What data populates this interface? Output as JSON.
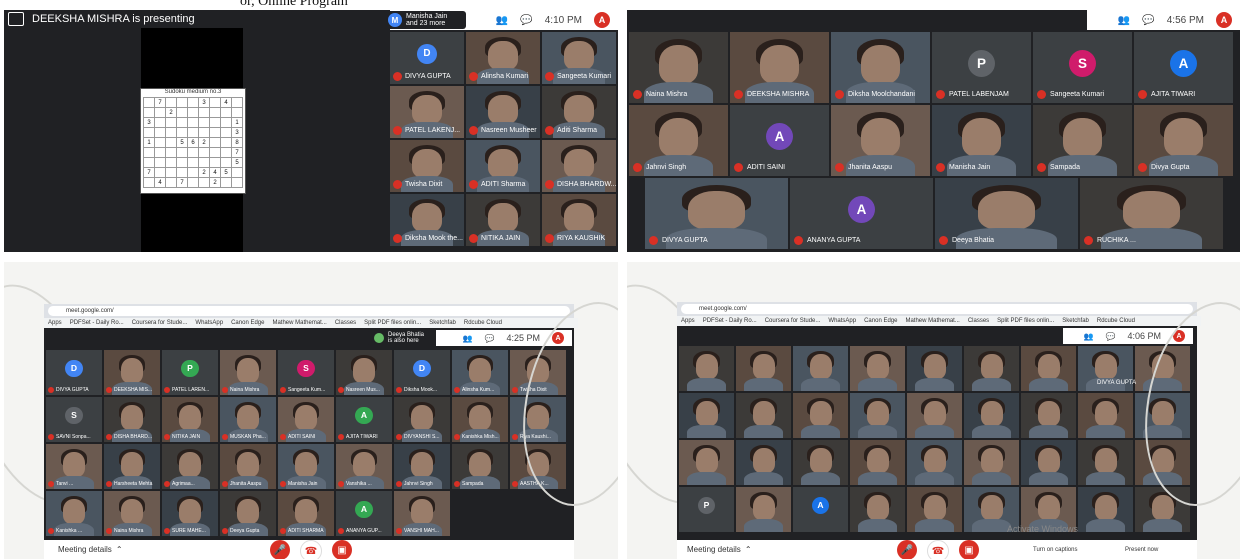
{
  "caption_fragment": "or, Online Program",
  "panel1": {
    "presenter_text": "DEEKSHA MISHRA is presenting",
    "joined_text": "Manisha Jain and 23 more",
    "joined_avatar": "M",
    "time": "4:10 PM",
    "self_avatar": "A",
    "sudoku_title": "Sudoku medium no.3",
    "sudoku_rows": [
      [
        "",
        "7",
        "",
        "",
        "",
        "3",
        "",
        "4",
        ""
      ],
      [
        "",
        "",
        "2",
        "",
        "",
        "",
        "",
        "",
        ""
      ],
      [
        "3",
        "",
        "",
        "",
        "",
        "",
        "",
        "",
        "1"
      ],
      [
        "",
        "",
        "",
        "",
        "",
        "",
        "",
        "",
        "3"
      ],
      [
        "1",
        "",
        "",
        "5",
        "6",
        "2",
        "",
        "",
        "8"
      ],
      [
        "",
        "",
        "",
        "",
        "",
        "",
        "",
        "",
        "7"
      ],
      [
        "",
        "",
        "",
        "",
        "",
        "",
        "",
        "",
        "5"
      ],
      [
        "7",
        "",
        "",
        "",
        "",
        "2",
        "4",
        "5",
        ""
      ],
      [
        "",
        "4",
        "",
        "7",
        "",
        "",
        "2",
        "",
        ""
      ]
    ],
    "tiles": [
      {
        "name": "DIVYA GUPTA",
        "avatar": "D"
      },
      {
        "name": "Alinsha Kumari"
      },
      {
        "name": "Sangeeta Kumari"
      },
      {
        "name": "PATEL LAKENJ..."
      },
      {
        "name": "Nasreen Musheer"
      },
      {
        "name": "Aditi Sharma"
      },
      {
        "name": "Twisha Dixit"
      },
      {
        "name": "ADITI Sharma"
      },
      {
        "name": "DISHA BHARDW..."
      },
      {
        "name": "Diksha Mook the..."
      },
      {
        "name": "NITIKA JAIN"
      },
      {
        "name": "RIYA KAUSHIK"
      }
    ]
  },
  "panel2": {
    "time": "4:56 PM",
    "self_avatar": "A",
    "tiles": [
      {
        "name": "Naina Mishra"
      },
      {
        "name": "DEEKSHA MISHRA"
      },
      {
        "name": "Diksha Moolchandani"
      },
      {
        "name": "PATEL LABENJAM",
        "avatar": "P"
      },
      {
        "name": "Sangeeta Kumari",
        "avatar": "S"
      },
      {
        "name": "AJITA TIWARI",
        "avatar": "A"
      },
      {
        "name": "Jahnvi Singh"
      },
      {
        "name": "ADITI SAINI",
        "avatar": "A"
      },
      {
        "name": "Jhanita Aaspu"
      },
      {
        "name": "Manisha Jain"
      },
      {
        "name": "Sampada"
      },
      {
        "name": "Divya Gupta"
      },
      {
        "name": "DIVYA GUPTA"
      },
      {
        "name": "ANANYA GUPTA",
        "avatar": "A"
      },
      {
        "name": "Deeya Bhatia"
      },
      {
        "name": "RUCHIKA ..."
      }
    ]
  },
  "panel3": {
    "url": "meet.google.com/",
    "bookmarks": [
      "Apps",
      "PDFSet - Daily Ro...",
      "Coursera for Stude...",
      "WhatsApp",
      "Canon Edge",
      "Mathew Mathemat...",
      "Classes",
      "Split PDF files onlin...",
      "Sketchfab",
      "Rdcube Cloud"
    ],
    "notice": "Deeya Bhatia is also here",
    "time": "4:25 PM",
    "self_avatar": "A",
    "meeting_details": "Meeting details",
    "tiles": [
      {
        "name": "DIVYA GUPTA",
        "avatar": "D"
      },
      {
        "name": "DEEKSHA MIS..."
      },
      {
        "name": "PATEL LAREN...",
        "avatar": "P"
      },
      {
        "name": "Naina Mishra"
      },
      {
        "name": "Sangeeta Kum...",
        "avatar": "S"
      },
      {
        "name": "Nasreen Mus..."
      },
      {
        "name": "Diksha Mook...",
        "avatar": "D"
      },
      {
        "name": "Alinsha Kum..."
      },
      {
        "name": "Twisha Dixit"
      },
      {
        "name": "SAVNI Sonpa...",
        "avatar": "S"
      },
      {
        "name": "DISHA BHARD..."
      },
      {
        "name": "NITIKA JAIN"
      },
      {
        "name": "MUSKAN Pha..."
      },
      {
        "name": "ADITI SAINI"
      },
      {
        "name": "AJITA TIWARI",
        "avatar": "A"
      },
      {
        "name": "DIVYANSHI S..."
      },
      {
        "name": "Kanishka Mish..."
      },
      {
        "name": "Riya Kaushi..."
      },
      {
        "name": "Tanvi ..."
      },
      {
        "name": "Harsheeta Mehta"
      },
      {
        "name": "Agrimaa..."
      },
      {
        "name": "Jhanita Aaspu"
      },
      {
        "name": "Manisha Jain"
      },
      {
        "name": "Vanshika ..."
      },
      {
        "name": "Jahnvi Singh"
      },
      {
        "name": "Sampada"
      },
      {
        "name": "AASTHA K..."
      },
      {
        "name": "Kanishka ..."
      },
      {
        "name": "Naina Mishra"
      },
      {
        "name": "SURE MAHE..."
      },
      {
        "name": "Deeya Gupta"
      },
      {
        "name": "ADITI SHARMA"
      },
      {
        "name": "ANANYA GUP...",
        "avatar": "A"
      },
      {
        "name": "VANSHI MAH..."
      }
    ]
  },
  "panel4": {
    "url": "meet.google.com/",
    "bookmarks": [
      "Apps",
      "PDFSet - Daily Ro...",
      "Coursera for Stude...",
      "WhatsApp",
      "Canon Edge",
      "Mathew Mathemat...",
      "Classes",
      "Split PDF files onlin...",
      "Sketchfab",
      "Rdcube Cloud"
    ],
    "time": "4:06 PM",
    "self_avatar": "A",
    "meeting_details": "Meeting details",
    "captions": "Turn on captions",
    "present": "Present now",
    "activate": "Activate Windows",
    "pinned_name": "DIVYA GUPTA",
    "tile_avatars": [
      "P",
      "A"
    ]
  },
  "colors": {
    "red": "#d93025",
    "meet_bg": "#202124",
    "blue": "#4285f4",
    "purple": "#7248b9",
    "green": "#34a853",
    "pink": "#d01b6b"
  }
}
